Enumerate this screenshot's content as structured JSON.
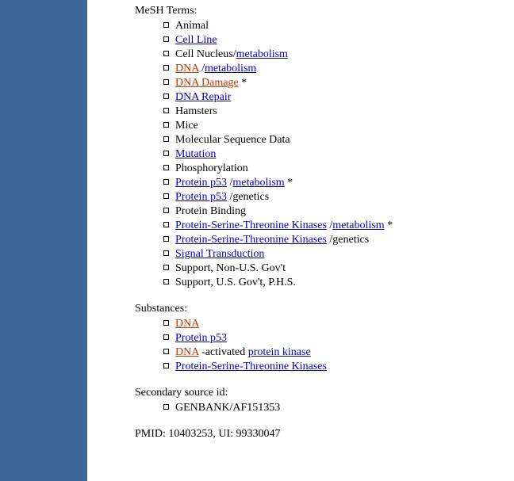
{
  "headings": {
    "mesh": "MeSH Terms:",
    "substances": "Substances:",
    "secondary": "Secondary source id:"
  },
  "mesh_terms": [
    {
      "parts": [
        {
          "kind": "text",
          "text": "Animal"
        }
      ]
    },
    {
      "parts": [
        {
          "kind": "link",
          "color": "blue",
          "text": "Cell Line"
        }
      ]
    },
    {
      "parts": [
        {
          "kind": "text",
          "text": "Cell Nucleus/"
        },
        {
          "kind": "link",
          "color": "blue",
          "text": "metabolism"
        }
      ]
    },
    {
      "parts": [
        {
          "kind": "link",
          "color": "red",
          "text": "DNA"
        },
        {
          "kind": "text",
          "text": " /"
        },
        {
          "kind": "link",
          "color": "blue",
          "text": "metabolism"
        }
      ]
    },
    {
      "parts": [
        {
          "kind": "link",
          "color": "red",
          "text": "DNA Damage"
        },
        {
          "kind": "text",
          "text": " *"
        }
      ]
    },
    {
      "parts": [
        {
          "kind": "link",
          "color": "blue",
          "text": "DNA Repair"
        }
      ]
    },
    {
      "parts": [
        {
          "kind": "text",
          "text": "Hamsters"
        }
      ]
    },
    {
      "parts": [
        {
          "kind": "text",
          "text": "Mice"
        }
      ]
    },
    {
      "parts": [
        {
          "kind": "text",
          "text": "Molecular Sequence Data"
        }
      ]
    },
    {
      "parts": [
        {
          "kind": "link",
          "color": "blue",
          "text": "Mutation"
        }
      ]
    },
    {
      "parts": [
        {
          "kind": "text",
          "text": "Phosphorylation"
        }
      ]
    },
    {
      "parts": [
        {
          "kind": "link",
          "color": "blue",
          "text": "Protein p53"
        },
        {
          "kind": "text",
          "text": " /"
        },
        {
          "kind": "link",
          "color": "blue",
          "text": "metabolism"
        },
        {
          "kind": "text",
          "text": " *"
        }
      ]
    },
    {
      "parts": [
        {
          "kind": "link",
          "color": "blue",
          "text": "Protein p53"
        },
        {
          "kind": "text",
          "text": " /genetics"
        }
      ]
    },
    {
      "parts": [
        {
          "kind": "text",
          "text": "Protein Binding"
        }
      ]
    },
    {
      "parts": [
        {
          "kind": "link",
          "color": "blue",
          "text": "Protein-Serine-Threonine Kinases"
        },
        {
          "kind": "text",
          "text": " /"
        },
        {
          "kind": "link",
          "color": "blue",
          "text": "metabolism"
        },
        {
          "kind": "text",
          "text": " *"
        }
      ]
    },
    {
      "parts": [
        {
          "kind": "link",
          "color": "blue",
          "text": "Protein-Serine-Threonine Kinases"
        },
        {
          "kind": "text",
          "text": " /genetics"
        }
      ]
    },
    {
      "parts": [
        {
          "kind": "link",
          "color": "blue",
          "text": "Signal Transduction"
        }
      ]
    },
    {
      "parts": [
        {
          "kind": "text",
          "text": "Support, Non-U.S. Gov't"
        }
      ]
    },
    {
      "parts": [
        {
          "kind": "text",
          "text": "Support, U.S. Gov't, P.H.S."
        }
      ]
    }
  ],
  "substances": [
    {
      "parts": [
        {
          "kind": "link",
          "color": "red",
          "text": "DNA"
        }
      ]
    },
    {
      "parts": [
        {
          "kind": "link",
          "color": "blue",
          "text": "Protein p53"
        }
      ]
    },
    {
      "parts": [
        {
          "kind": "link",
          "color": "red",
          "text": "DNA"
        },
        {
          "kind": "text",
          "text": " -activated "
        },
        {
          "kind": "link",
          "color": "blue",
          "text": "protein kinase"
        }
      ]
    },
    {
      "parts": [
        {
          "kind": "link",
          "color": "blue",
          "text": "Protein-Serine-Threonine Kinases"
        }
      ]
    }
  ],
  "secondary_sources": [
    {
      "parts": [
        {
          "kind": "text",
          "text": "GENBANK/AF151353"
        }
      ]
    }
  ],
  "pmid_line": "PMID: 10403253, UI: 99330047"
}
